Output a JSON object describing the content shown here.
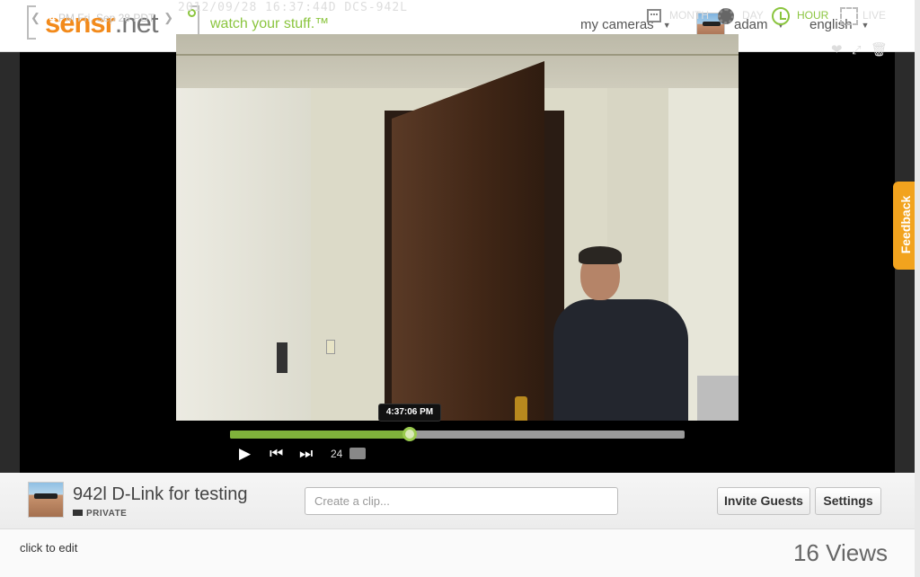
{
  "header": {
    "logo_brand": "sensr",
    "logo_tld": ".net",
    "tagline": "watch your stuff.™",
    "nav": {
      "my_cameras": "my cameras",
      "user": "adam",
      "language": "english"
    }
  },
  "viewer": {
    "date_hour": "4",
    "date_rest": "PM Fri, Sep 28 PDT",
    "overlay_stamp": "2012/09/28 16:37:44D DCS-942L",
    "views": {
      "month": "MONTH",
      "day": "DAY",
      "hour": "HOUR",
      "live": "LIVE",
      "active": "HOUR"
    },
    "timeline": {
      "tooltip": "4:37:06 PM",
      "progress": 0.395
    },
    "clip_count": "24",
    "feedback_label": "Feedback"
  },
  "camera": {
    "title": "942l D-Link for testing",
    "privacy": "PRIVATE",
    "clip_placeholder": "Create a clip...",
    "invite_label": "Invite Guests",
    "settings_label": "Settings",
    "click_to_edit": "click to edit",
    "view_count": "16",
    "views_label": "Views"
  },
  "colors": {
    "accent_green": "#8bc53f",
    "brand_orange": "#f28a1b",
    "feedback_orange": "#f2a31e"
  }
}
